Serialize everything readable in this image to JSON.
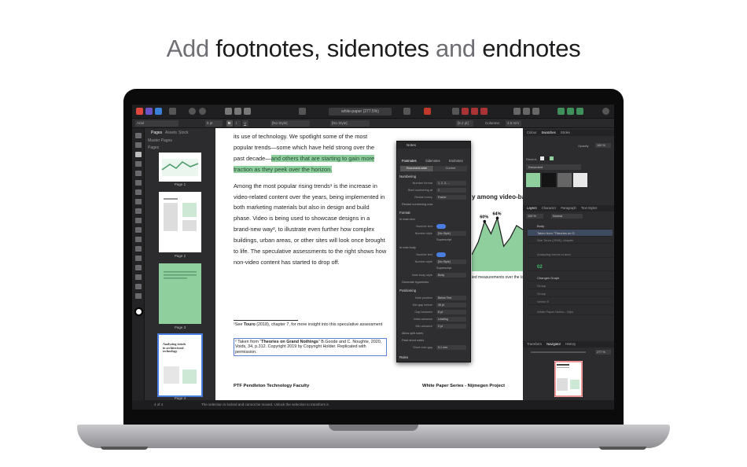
{
  "headline": {
    "w1": "Add",
    "w2": "footnotes,",
    "w3": "sidenotes",
    "w4": "and",
    "w5": "endnotes"
  },
  "app": {
    "doc_title": "white-paper (277.5%)",
    "ctx": {
      "font": "Arial",
      "size": "8 pt",
      "style": "[No Style]",
      "style2": "[No Style]",
      "para_size": "[5.2 pt]",
      "columns_label": "Columns:",
      "columns_val": "4.5 mm"
    }
  },
  "pages_panel": {
    "tabs": [
      "Pages",
      "Assets",
      "Stock"
    ],
    "master": "Master Pages",
    "section": "Pages",
    "thumbs": [
      "Page 1",
      "Page 2",
      "Page 3",
      "Page 4"
    ],
    "thumb4_title": "Analyzing trends in architectural technology"
  },
  "document": {
    "p1_a": "its use of technology. We spotlight some of the most popular trends—some which have held strong over the past decade—",
    "p1_hl": "and others that are starting to gain more traction as they peek over the horizon.",
    "p2": "Among the most popular rising trends¹ is the increase in video-related content over the years, being implemented in both marketing materials but also in design and build phase. Video is being used to showcase designs in a brand-new way², to illustrate even further how complex buildings, urban areas, or other sites will look once brought to life. The speculative assessments to the right shows how non-video content has started to drop off.",
    "fn1_pre": "¹See ",
    "fn1_bold": "Touro",
    "fn1_post": " (2018), chapter 7, for more insight into this speculative assessment",
    "fn2_pre": "² Taken from “",
    "fn2_bold": "Theories on Grand Nothings",
    "fn2_post": "” B.Goode and C. Noughte, 2020, Voids, 34, p.312. Copyright 2019 by Copyright Holder. Replicated with permission.",
    "footer_left": "PTF Pendleton Technology Faculty",
    "footer_right": "White Paper Series - Nijmegen Project",
    "chart_title": "y among video-based",
    "chart_caption": "ied measurements over the las"
  },
  "chart_data": {
    "type": "area",
    "x": [
      0,
      1,
      2,
      3,
      4,
      5,
      6,
      7,
      8
    ],
    "values": [
      20,
      35,
      60,
      45,
      64,
      30,
      40,
      55,
      50
    ],
    "data_labels": [
      "60%",
      "64%"
    ],
    "title": "",
    "colors": {
      "fill": "#8fcf9e",
      "stroke": "#1a1a1a"
    }
  },
  "notes_dialog": {
    "title": "Notes",
    "tabs": [
      "Footnotes",
      "Sidenotes",
      "Endnotes"
    ],
    "subtabs": [
      "Document-wide",
      "Current"
    ],
    "numbering": "Numbering",
    "number_format_lbl": "Number format",
    "number_format": "1, 2, 3, ...",
    "start_lbl": "Start numbering at",
    "start": "1",
    "restart_lbl": "Restart every",
    "restart": "Frame",
    "restart_chk": "Restart numbering now",
    "format": "Format",
    "in_text": "In main text",
    "number_text_lbl": "Number text",
    "number_style_lbl": "Number style",
    "number_style": "[No Style]",
    "superscript": "Superscript",
    "in_body": "In note body",
    "note_body_lbl": "Note body style",
    "note_body": "Body",
    "hyperlinks": "Generate hyperlinks",
    "positioning": "Positioning",
    "note_pos_lbl": "Note position",
    "note_pos": "Below Text",
    "min_gap_lbl": "Min gap before",
    "min_gap": "45 pt",
    "gap_lbl": "Gap between",
    "gap": "8 pt",
    "initial_adv_lbl": "Initial advance",
    "initial_adv": "Leading",
    "min_adv_lbl": "Min advance",
    "min_adv": "0 pt",
    "allow_split": "Allow split notes",
    "pack_short": "Pack short notes",
    "short_gap_lbl": "Short note gap",
    "short_gap": "5.1 mm",
    "rules": "Rules"
  },
  "right_panel": {
    "tabs_top": [
      "Colour",
      "Swatches",
      "Stroke"
    ],
    "opacity_lbl": "Opacity",
    "opacity": "100 %",
    "recent": "Recent:",
    "palette": "Document",
    "tabs_mid": [
      "Layers",
      "Character",
      "Paragraph",
      "Text Styles"
    ],
    "layer_opacity": "100 %",
    "blend": "Normal",
    "layers": [
      "Body",
      "Taken from \"Theories on G",
      "See Touro (2018), chapter",
      "Analyzing trends in arch",
      "02",
      "Changes Graph",
      "Group",
      "Group",
      "Vector 8",
      "White Paper Series - Nijm"
    ],
    "tabs_bot": [
      "Transform",
      "Navigator",
      "History"
    ],
    "zoom": "277 %"
  },
  "status": {
    "page": "4 of 4",
    "message": "The selection is locked and cannot be moved. Unlock the selection to transform it."
  }
}
